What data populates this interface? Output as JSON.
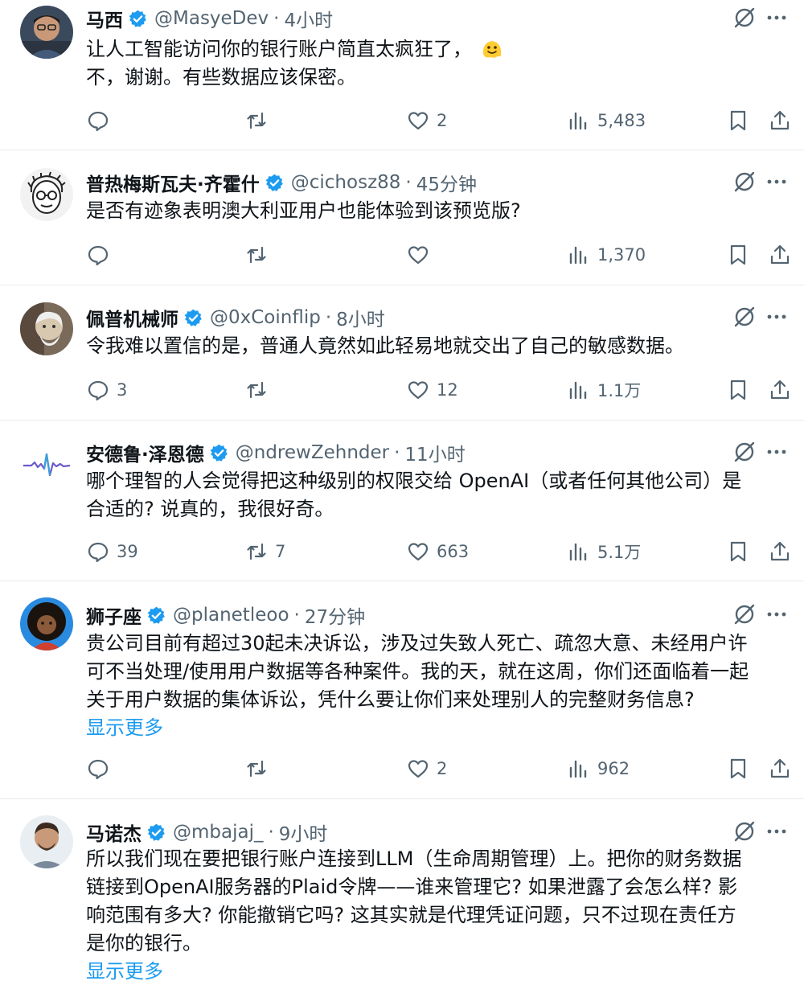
{
  "tweets": [
    {
      "name": "马西",
      "handle": "@MasyeDev",
      "time": "4小时",
      "lines": [
        "让人工智能访问你的银行账户简直太疯狂了，",
        "不，谢谢。有些数据应该保密。"
      ],
      "emoji": "melting-face-emoji",
      "replies": "",
      "retweets": "",
      "likes": "2",
      "views": "5,483",
      "show_more": ""
    },
    {
      "name": "普热梅斯瓦夫·齐霍什",
      "handle": "@cichosz88",
      "time": "45分钟",
      "lines": [
        "是否有迹象表明澳大利亚用户也能体验到该预览版?"
      ],
      "replies": "",
      "retweets": "",
      "likes": "",
      "views": "1,370",
      "show_more": ""
    },
    {
      "name": "佩普机械师",
      "handle": "@0xCoinflip",
      "time": "8小时",
      "lines": [
        "令我难以置信的是，普通人竟然如此轻易地就交出了自己的敏感数据。"
      ],
      "replies": "3",
      "retweets": "",
      "likes": "12",
      "views": "1.1万",
      "show_more": ""
    },
    {
      "name": "安德鲁·泽恩德",
      "handle": "@ndrewZehnder",
      "time": "11小时",
      "lines": [
        "哪个理智的人会觉得把这种级别的权限交给 OpenAI（或者任何其他公司）是",
        "合适的? 说真的，我很好奇。"
      ],
      "replies": "39",
      "retweets": "7",
      "likes": "663",
      "views": "5.1万",
      "show_more": ""
    },
    {
      "name": "狮子座",
      "handle": "@planetleoo",
      "time": "27分钟",
      "lines": [
        "贵公司目前有超过30起未决诉讼，涉及过失致人死亡、疏忽大意、未经用户许",
        "可不当处理/使用用户数据等各种案件。我的天，就在这周，你们还面临着一起",
        "关于用户数据的集体诉讼，凭什么要让你们来处理别人的完整财务信息?"
      ],
      "replies": "",
      "retweets": "",
      "likes": "2",
      "views": "962",
      "show_more": "显示更多"
    },
    {
      "name": "马诺杰",
      "handle": "@mbajaj_",
      "time": "9小时",
      "lines": [
        "所以我们现在要把银行账户连接到LLM（生命周期管理）上。把你的财务数据",
        "链接到OpenAI服务器的Plaid令牌——谁来管理它? 如果泄露了会怎么样? 影",
        "响范围有多大? 你能撤销它吗? 这其实就是代理凭证问题，只不过现在责任方",
        "是你的银行。"
      ],
      "replies": "",
      "retweets": "",
      "likes": "",
      "views": "",
      "show_more": "显示更多"
    }
  ],
  "icons": {
    "verified": "verified-badge-icon",
    "grok": "grok-icon",
    "more": "more-icon",
    "reply": "reply-icon",
    "retweet": "retweet-icon",
    "like": "like-icon",
    "views": "views-icon",
    "bookmark": "bookmark-icon",
    "share": "share-icon"
  },
  "colors": {
    "verified_blue": "#1d9bf0",
    "link_blue": "#1d9bf0",
    "text": "#0f1419",
    "secondary": "#536471",
    "divider": "#e6e9eb"
  }
}
